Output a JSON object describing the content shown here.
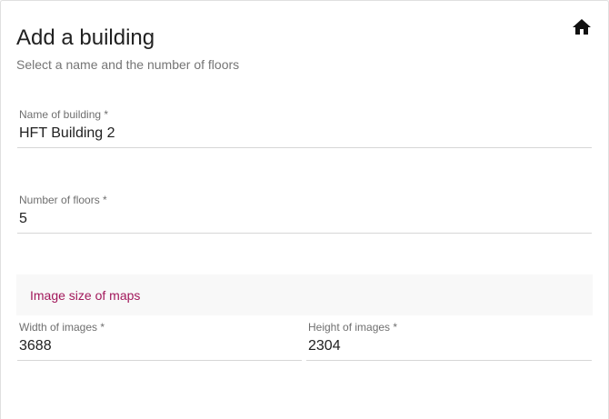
{
  "header": {
    "title": "Add a building",
    "subtitle": "Select a name and the number of floors"
  },
  "icons": {
    "home": "home-icon"
  },
  "form": {
    "building_name": {
      "label": "Name of building *",
      "value": "HFT Building 2"
    },
    "floors": {
      "label": "Number of floors *",
      "value": "5"
    }
  },
  "map_size": {
    "section_title": "Image size of maps",
    "width": {
      "label": "Width of images *",
      "value": "3688"
    },
    "height": {
      "label": "Height of images *",
      "value": "2304"
    }
  },
  "colors": {
    "accent": "#a2185b",
    "text_primary": "#212121",
    "text_secondary": "#757575",
    "section_bg": "#f8f8f8"
  }
}
